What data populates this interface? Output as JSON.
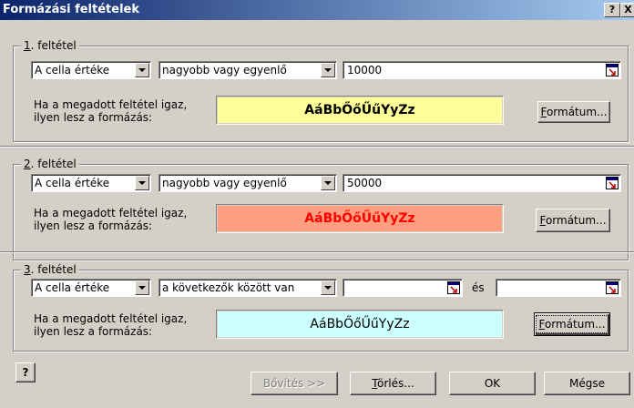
{
  "window": {
    "title": "Formázási feltételek",
    "help_btn": "?",
    "close_btn": "X"
  },
  "conditions": [
    {
      "label_ul": "1",
      "label_rest": ". feltétel",
      "type": "A cella értéke",
      "operator": "nagyobb vagy egyenlő",
      "value1": "10000",
      "hint1": "Ha a megadott feltétel igaz,",
      "hint2": "ilyen lesz a formázás:",
      "preview_text": "AáBbŐőŰűYyZz",
      "format_ul": "F",
      "format_rest": "ormátum...",
      "colors": {
        "bg": "#ffff99",
        "fg": "#000000"
      }
    },
    {
      "label_ul": "2",
      "label_rest": ". feltétel",
      "type": "A cella értéke",
      "operator": "nagyobb vagy egyenlő",
      "value1": "50000",
      "hint1": "Ha a megadott feltétel igaz,",
      "hint2": "ilyen lesz a formázás:",
      "preview_text": "AáBbŐőŰűYyZz",
      "format_ul": "F",
      "format_rest": "ormátum...",
      "colors": {
        "bg": "#ff9f80",
        "fg": "#ff0000"
      }
    },
    {
      "label_ul": "3",
      "label_rest": ". feltétel",
      "type": "A cella értéke",
      "operator": "a következők között van",
      "value1": "",
      "and_label": "és",
      "value2": "",
      "hint1": "Ha a megadott feltétel igaz,",
      "hint2": "ilyen lesz a formázás:",
      "preview_text": "AáBbŐőŰűYyZz",
      "format_ul": "F",
      "format_rest": "ormátum...",
      "colors": {
        "bg": "#ccffff",
        "fg": "#000000"
      }
    }
  ],
  "footer": {
    "help_icon": "?",
    "expand_label": "Bővítés >>",
    "delete_ul": "T",
    "delete_rest": "örlés...",
    "ok_label": "OK",
    "cancel_label": "Mégse"
  }
}
